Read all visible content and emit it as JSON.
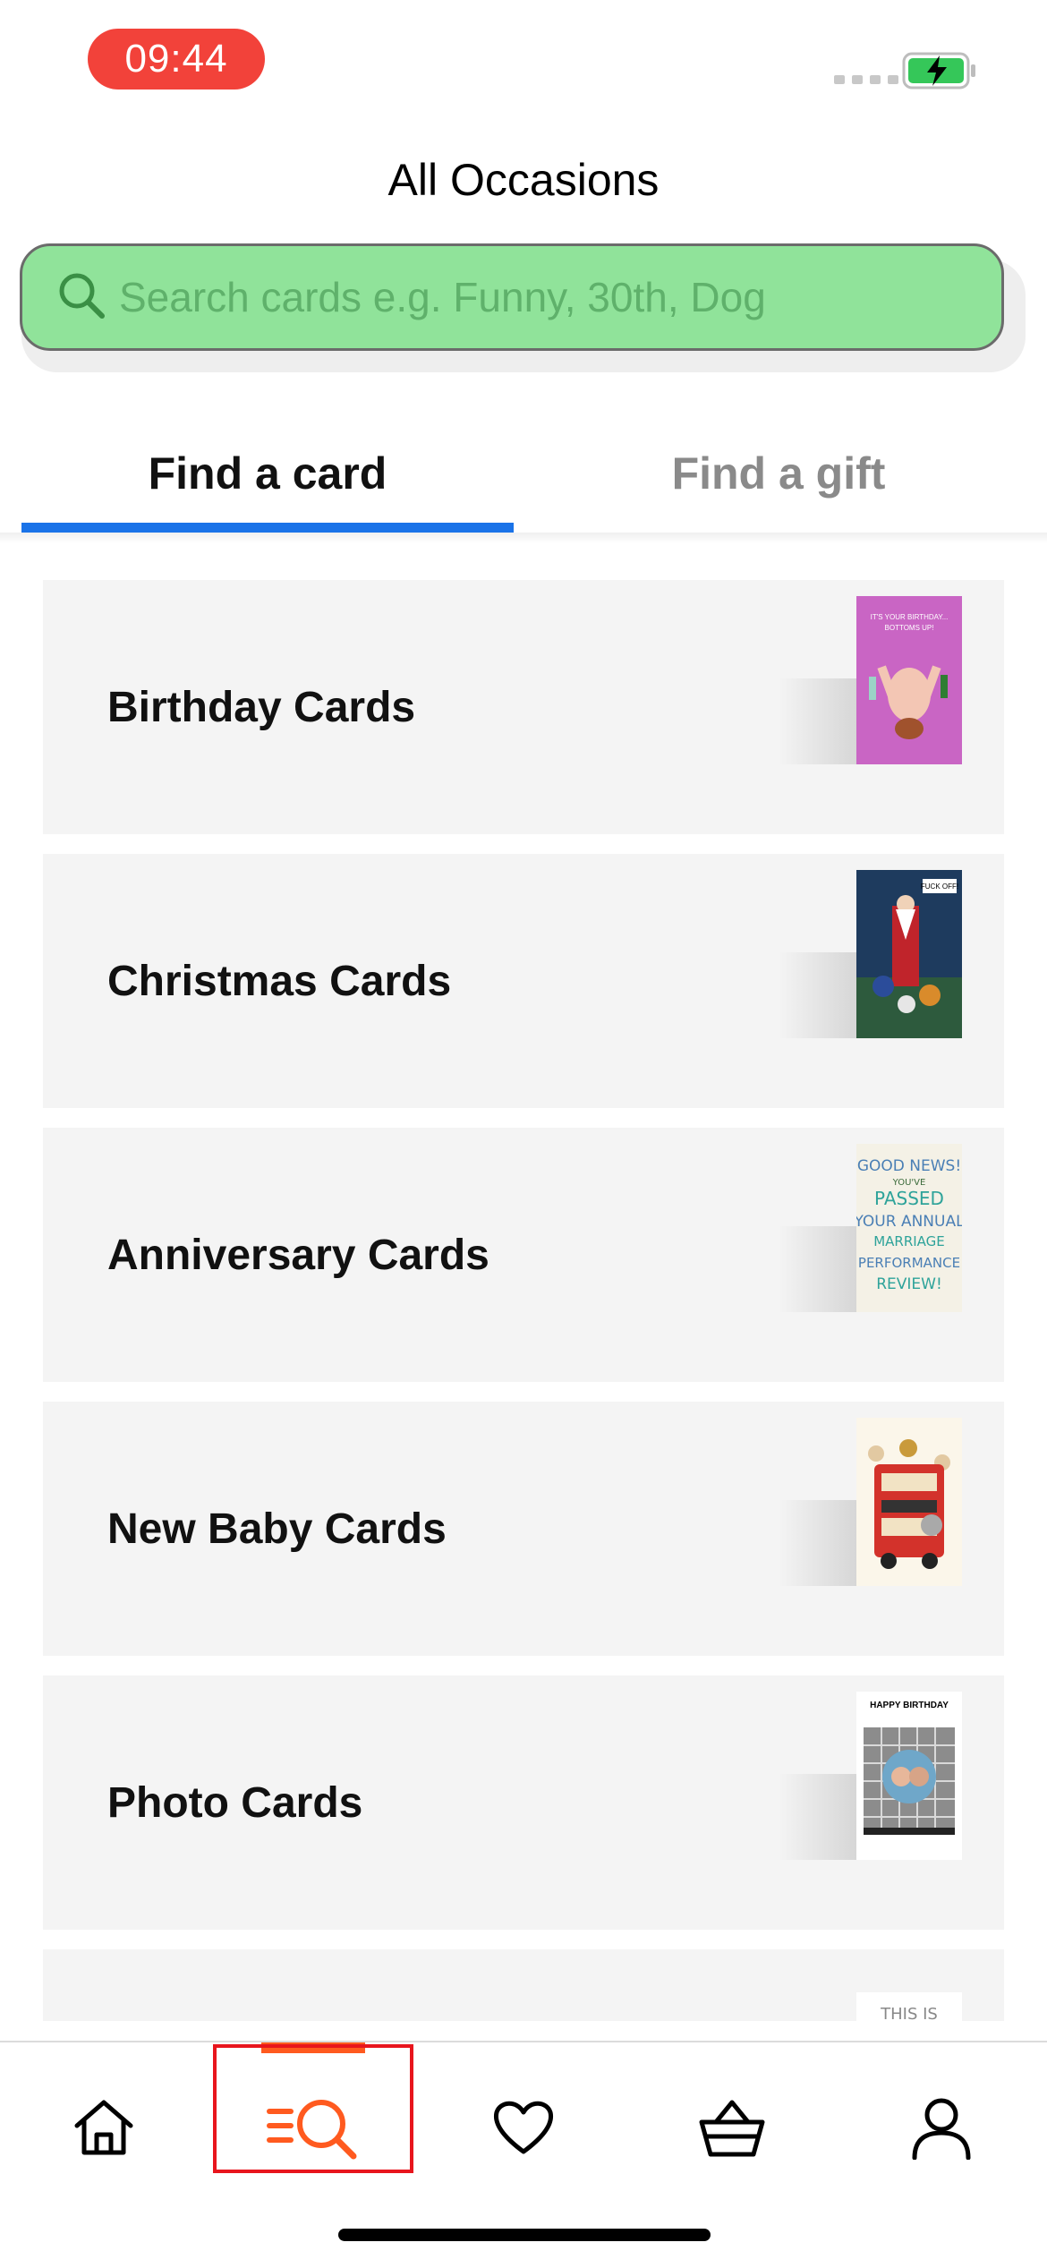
{
  "status_bar": {
    "time": "09:44"
  },
  "header": {
    "title": "All Occasions"
  },
  "search": {
    "placeholder": "Search cards e.g. Funny, 30th, Dog"
  },
  "tabs": [
    {
      "label": "Find a card",
      "selected": true
    },
    {
      "label": "Find a gift",
      "selected": false
    }
  ],
  "categories": [
    {
      "label": "Birthday Cards",
      "thumb_text": "IT'S YOUR BIRTHDAY... BOTTOMS UP!"
    },
    {
      "label": "Christmas Cards",
      "thumb_text": "FUCK OFF!"
    },
    {
      "label": "Anniversary Cards",
      "thumb_text": "GOOD NEWS! YOU'VE PASSED YOUR ANNUAL MARRIAGE PERFORMANCE REVIEW!"
    },
    {
      "label": "New Baby Cards",
      "thumb_text": ""
    },
    {
      "label": "Photo Cards",
      "thumb_text": "HAPPY BIRTHDAY"
    },
    {
      "label": "",
      "thumb_text": "THIS IS GOING"
    }
  ],
  "bottom_nav": [
    {
      "icon": "home-icon",
      "active": false
    },
    {
      "icon": "browse-search-icon",
      "active": true
    },
    {
      "icon": "heart-icon",
      "active": false
    },
    {
      "icon": "basket-icon",
      "active": false
    },
    {
      "icon": "account-icon",
      "active": false
    }
  ],
  "colors": {
    "accent": "#1a73e8",
    "search_bg": "#90e39a",
    "nav_active": "#ff5a1f",
    "time_pill": "#f2423a"
  }
}
